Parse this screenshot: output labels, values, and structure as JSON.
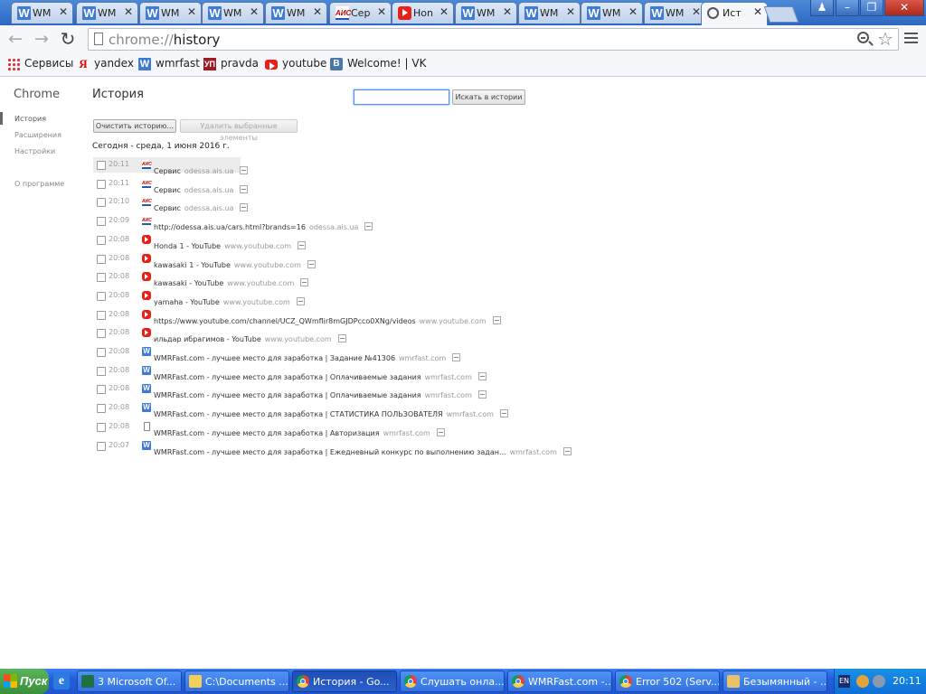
{
  "tabs": [
    {
      "label": "WMRFast.com",
      "icon": "wmrfast-icon",
      "active": false
    },
    {
      "label": "WMRFast.com",
      "icon": "wmrfast-icon",
      "active": false
    },
    {
      "label": "WMRFast.com",
      "icon": "wmrfast-icon",
      "active": false
    },
    {
      "label": "WMRFast.com",
      "icon": "wmrfast-icon",
      "active": false
    },
    {
      "label": "WMRFast.com",
      "icon": "wmrfast-icon",
      "active": false
    },
    {
      "label": "Сервис",
      "icon": "ais-icon",
      "active": false
    },
    {
      "label": "Honda",
      "icon": "youtube-icon",
      "active": false
    },
    {
      "label": "WMRFast.com",
      "icon": "wmrfast-icon",
      "active": false
    },
    {
      "label": "WMRFast.com",
      "icon": "wmrfast-icon",
      "active": false
    },
    {
      "label": "WMRFast.com",
      "icon": "wmrfast-icon",
      "active": false
    },
    {
      "label": "WMRFast.com",
      "icon": "wmrfast-icon",
      "active": false
    },
    {
      "label": "История",
      "icon": "history-icon",
      "active": true
    }
  ],
  "tab_short_labels": [
    "WM",
    "WM",
    "WM",
    "WM",
    "WM",
    "Сер",
    "Hon",
    "WM",
    "WM",
    "WM",
    "WM",
    "Ист"
  ],
  "toolbar": {
    "url_scheme": "chrome://",
    "url_rest": "history"
  },
  "bookmarks": [
    {
      "label": "Сервисы",
      "icon": "apps-icon"
    },
    {
      "label": "yandex",
      "icon": "yandex-icon"
    },
    {
      "label": "wmrfast",
      "icon": "wmrfast-icon"
    },
    {
      "label": "pravda",
      "icon": "pravda-icon"
    },
    {
      "label": "youtube",
      "icon": "youtube-icon"
    },
    {
      "label": "Welcome! | VK",
      "icon": "vk-icon"
    }
  ],
  "sidebar": {
    "title": "Chrome",
    "items": [
      {
        "label": "История",
        "active": true
      },
      {
        "label": "Расширения",
        "active": false
      },
      {
        "label": "Настройки",
        "active": false
      },
      {
        "label": "О программе",
        "active": false
      }
    ]
  },
  "main": {
    "title": "История",
    "search_placeholder": "",
    "search_button": "Искать в истории",
    "clear_button": "Очистить историю...",
    "delete_button": "Удалить выбранные элементы",
    "day_heading": "Сегодня - среда, 1 июня 2016 г."
  },
  "history": [
    {
      "time": "20:11",
      "icon": "ais-icon",
      "title": "Сервис",
      "domain": "odessa.ais.ua"
    },
    {
      "time": "20:11",
      "icon": "ais-icon",
      "title": "Сервис",
      "domain": "odessa.ais.ua"
    },
    {
      "time": "20:10",
      "icon": "ais-icon",
      "title": "Сервис",
      "domain": "odessa.ais.ua"
    },
    {
      "time": "20:09",
      "icon": "ais-icon",
      "title": "http://odessa.ais.ua/cars.html?brands=16",
      "domain": "odessa.ais.ua"
    },
    {
      "time": "20:08",
      "icon": "youtube-icon",
      "title": "Honda 1 - YouTube",
      "domain": "www.youtube.com"
    },
    {
      "time": "20:08",
      "icon": "youtube-icon",
      "title": "kawasaki 1 - YouTube",
      "domain": "www.youtube.com"
    },
    {
      "time": "20:08",
      "icon": "youtube-icon",
      "title": "kawasaki - YouTube",
      "domain": "www.youtube.com"
    },
    {
      "time": "20:08",
      "icon": "youtube-icon",
      "title": "yamaha - YouTube",
      "domain": "www.youtube.com"
    },
    {
      "time": "20:08",
      "icon": "youtube-icon",
      "title": "https://www.youtube.com/channel/UCZ_QWmflir8mGJDPcco0XNg/videos",
      "domain": "www.youtube.com"
    },
    {
      "time": "20:08",
      "icon": "youtube-icon",
      "title": "ильдар ибрагимов - YouTube",
      "domain": "www.youtube.com"
    },
    {
      "time": "20:08",
      "icon": "wmrfast-icon",
      "title": "WMRFast.com - лучшее место для заработка | Задание №41306",
      "domain": "wmrfast.com"
    },
    {
      "time": "20:08",
      "icon": "wmrfast-icon",
      "title": "WMRFast.com - лучшее место для заработка | Оплачиваемые задания",
      "domain": "wmrfast.com"
    },
    {
      "time": "20:08",
      "icon": "wmrfast-icon",
      "title": "WMRFast.com - лучшее место для заработка | Оплачиваемые задания",
      "domain": "wmrfast.com"
    },
    {
      "time": "20:08",
      "icon": "wmrfast-icon",
      "title": "WMRFast.com - лучшее место для заработка | СТАТИСТИКА ПОЛЬЗОВАТЕЛЯ",
      "domain": "wmrfast.com"
    },
    {
      "time": "20:08",
      "icon": "page-icon",
      "title": "WMRFast.com - лучшее место для заработка | Авторизация",
      "domain": "wmrfast.com"
    },
    {
      "time": "20:07",
      "icon": "wmrfast-icon",
      "title": "WMRFast.com - лучшее место для заработка | Ежедневный конкурс по выполнению задан...",
      "domain": "wmrfast.com"
    }
  ],
  "taskbar": {
    "start_label": "Пуск",
    "tasks": [
      {
        "label": "3 Microsoft Of...",
        "icon": "excel-icon",
        "active": false
      },
      {
        "label": "C:\\Documents ...",
        "icon": "folder-icon",
        "active": false
      },
      {
        "label": "История - Go...",
        "icon": "chrome-icon",
        "active": true
      },
      {
        "label": "Слушать онла...",
        "icon": "chrome-icon",
        "active": false
      },
      {
        "label": "WMRFast.com -...",
        "icon": "chrome-icon",
        "active": false
      },
      {
        "label": "Error 502 (Serv...",
        "icon": "chrome-icon",
        "active": false
      },
      {
        "label": "Безымянный - ...",
        "icon": "paint-icon",
        "active": false
      }
    ],
    "language": "EN",
    "clock": "20:11"
  },
  "colors": {
    "titlebar": "#2d68c2",
    "taskbar": "#245edb",
    "search_focus": "#4d90fe"
  }
}
